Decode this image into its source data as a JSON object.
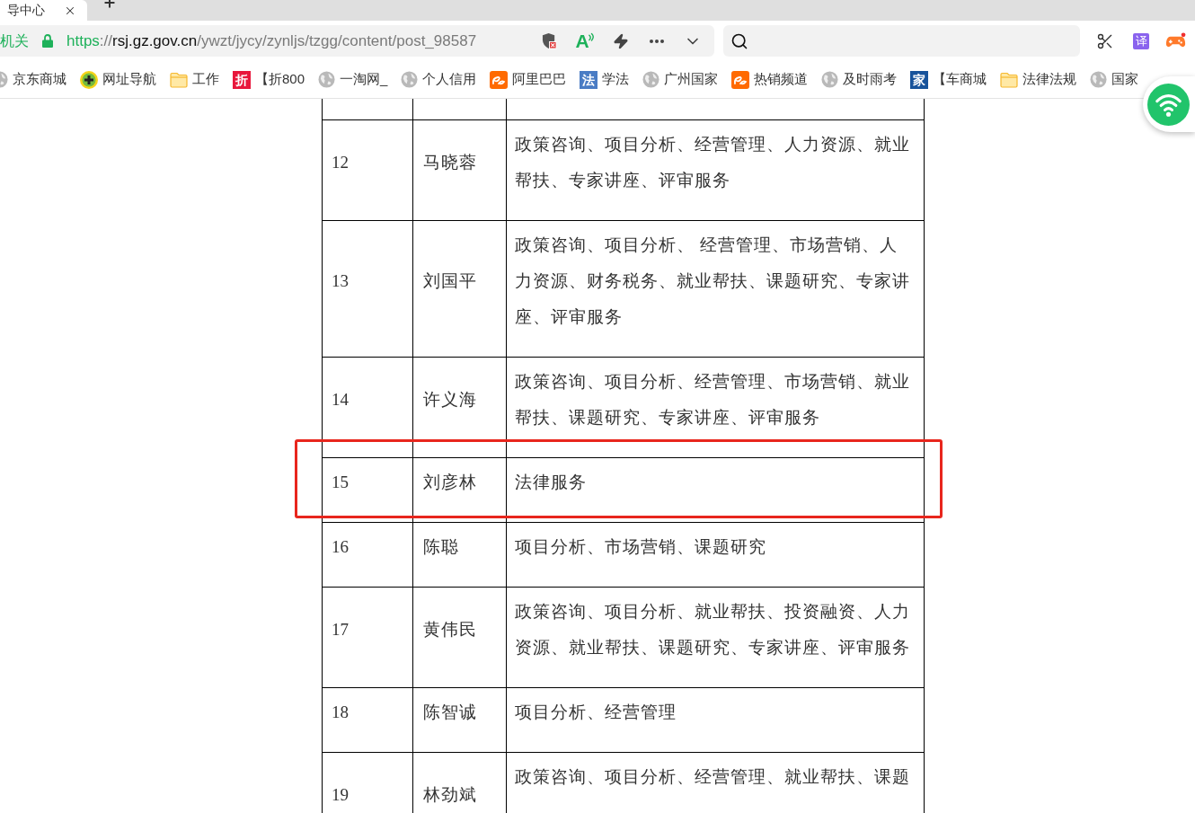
{
  "tabs": [
    {
      "title": "导中心",
      "selected": true
    }
  ],
  "address_bar": {
    "site_name": "机关",
    "url_parts": [
      {
        "text": "https",
        "kind": "scheme"
      },
      {
        "text": "://",
        "kind": "separator"
      },
      {
        "text": "rsj.gz.gov.cn",
        "kind": "host"
      },
      {
        "text": "/ywzt/jycy/zynljs/tzgg/content/post_98587",
        "kind": "path"
      }
    ],
    "reader_glyph": "A"
  },
  "toolbar": {
    "translate_glyph": "译"
  },
  "bookmarks": [
    {
      "label": "京东商城",
      "kind": "globe"
    },
    {
      "label": "网址导航",
      "kind": "nav"
    },
    {
      "label": "工作",
      "kind": "folder"
    },
    {
      "label": "【折800",
      "kind": "badge",
      "badge": "折",
      "color": "#e8173c"
    },
    {
      "label": "一淘网_",
      "kind": "globe"
    },
    {
      "label": "个人信用",
      "kind": "globe"
    },
    {
      "label": "阿里巴巴",
      "kind": "swirl"
    },
    {
      "label": "学法",
      "kind": "badge",
      "badge": "法",
      "color": "#4a7cc4"
    },
    {
      "label": "广州国家",
      "kind": "globe"
    },
    {
      "label": "热销频道",
      "kind": "swirl"
    },
    {
      "label": "及时雨考",
      "kind": "globe"
    },
    {
      "label": "【车商城",
      "kind": "badge",
      "badge": "家",
      "color": "#17539b"
    },
    {
      "label": "法律法规",
      "kind": "folder"
    },
    {
      "label": "国家",
      "kind": "globe"
    }
  ],
  "table": {
    "rows": [
      {
        "number": "12",
        "name": "马晓蓉",
        "services": "政策咨询、项目分析、经营管理、人力资源、就业帮扶、专家讲座、评审服务",
        "highlighted": false
      },
      {
        "number": "13",
        "name": "刘国平",
        "services": "政策咨询、项目分析、 经营管理、市场营销、人力资源、财务税务、就业帮扶、课题研究、专家讲座、评审服务",
        "highlighted": false
      },
      {
        "number": "14",
        "name": "许义海",
        "services": "政策咨询、项目分析、经营管理、市场营销、就业帮扶、课题研究、专家讲座、评审服务",
        "highlighted": false
      },
      {
        "number": "15",
        "name": "刘彦林",
        "services": "法律服务",
        "highlighted": true
      },
      {
        "number": "16",
        "name": "陈聪",
        "services": "项目分析、市场营销、课题研究",
        "highlighted": false
      },
      {
        "number": "17",
        "name": "黄伟民",
        "services": "政策咨询、项目分析、就业帮扶、投资融资、人力资源、就业帮扶、课题研究、专家讲座、评审服务",
        "highlighted": false
      },
      {
        "number": "18",
        "name": "陈智诚",
        "services": "项目分析、经营管理",
        "highlighted": false
      },
      {
        "number": "19",
        "name": "林劲斌",
        "services": "政策咨询、项目分析、经营管理、就业帮扶、课题",
        "highlighted": false
      }
    ]
  }
}
